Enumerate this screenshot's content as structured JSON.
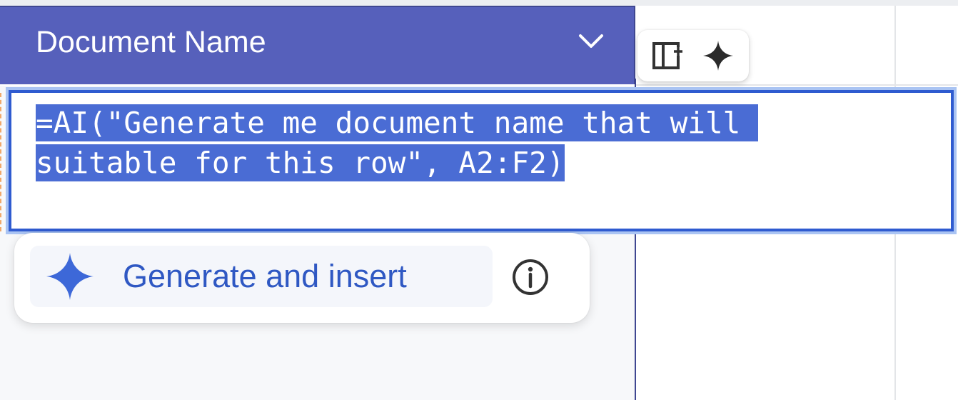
{
  "column_header": {
    "label": "Document Name",
    "dropdown_icon": "chevron-down-icon",
    "background": "#5660bb"
  },
  "column_toolbar": {
    "icons": [
      "insert-column-icon",
      "sparkle-icon"
    ]
  },
  "formula_editor": {
    "line1": "=AI(\"Generate me document name that will ",
    "line2": "suitable for this row\", A2:F2)",
    "selection_color": "#4a6cd4",
    "border_color": "#2f5bd0"
  },
  "generate_card": {
    "button_label": "Generate and insert",
    "button_icon": "sparkle-icon",
    "info_icon": "info-icon",
    "accent": "#2f58c3"
  }
}
